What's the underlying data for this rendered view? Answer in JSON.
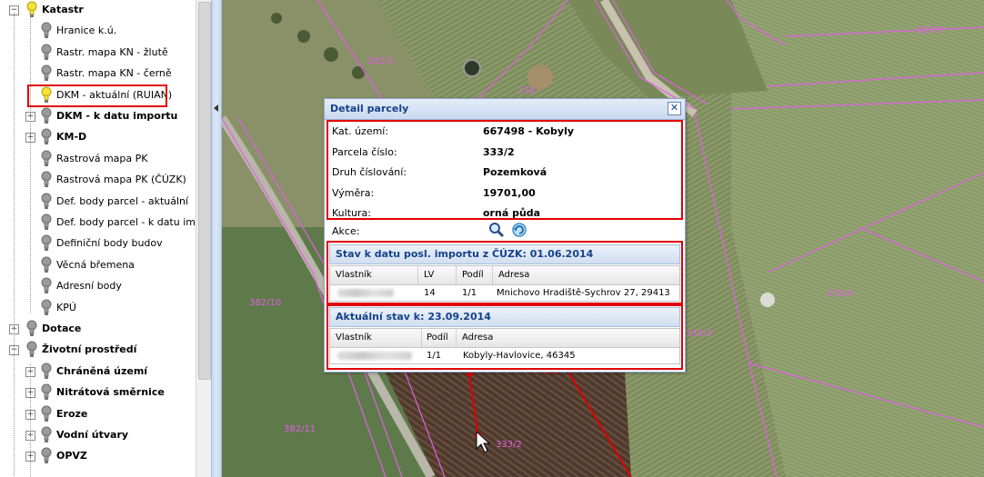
{
  "tree": {
    "items": [
      {
        "label": "Katastr",
        "level": 0,
        "bold": true,
        "expander": "−",
        "bulb": "yellow"
      },
      {
        "label": "Hranice k.ú.",
        "level": 1,
        "bold": false,
        "expander": "",
        "bulb": "gray"
      },
      {
        "label": "Rastr. mapa KN - žlutě",
        "level": 1,
        "bold": false,
        "expander": "",
        "bulb": "gray"
      },
      {
        "label": "Rastr. mapa KN - černě",
        "level": 1,
        "bold": false,
        "expander": "",
        "bulb": "gray"
      },
      {
        "label": "DKM - aktuální (RUIAN)",
        "level": 1,
        "bold": false,
        "expander": "",
        "bulb": "yellow"
      },
      {
        "label": "DKM - k datu importu",
        "level": 1,
        "bold": true,
        "expander": "+",
        "bulb": "gray"
      },
      {
        "label": "KM-D",
        "level": 1,
        "bold": true,
        "expander": "+",
        "bulb": "gray"
      },
      {
        "label": "Rastrová mapa PK",
        "level": 1,
        "bold": false,
        "expander": "",
        "bulb": "gray"
      },
      {
        "label": "Rastrová mapa PK (ČÚZK)",
        "level": 1,
        "bold": false,
        "expander": "",
        "bulb": "gray"
      },
      {
        "label": "Def. body parcel - aktuální",
        "level": 1,
        "bold": false,
        "expander": "",
        "bulb": "gray"
      },
      {
        "label": "Def. body parcel - k datu impo",
        "level": 1,
        "bold": false,
        "expander": "",
        "bulb": "gray"
      },
      {
        "label": "Definiční body budov",
        "level": 1,
        "bold": false,
        "expander": "",
        "bulb": "gray"
      },
      {
        "label": "Věcná břemena",
        "level": 1,
        "bold": false,
        "expander": "",
        "bulb": "gray"
      },
      {
        "label": "Adresní body",
        "level": 1,
        "bold": false,
        "expander": "",
        "bulb": "gray"
      },
      {
        "label": "KPÚ",
        "level": 1,
        "bold": false,
        "expander": "",
        "bulb": "gray"
      },
      {
        "label": "Dotace",
        "level": 0,
        "bold": true,
        "expander": "+",
        "bulb": "gray"
      },
      {
        "label": "Životní prostředí",
        "level": 0,
        "bold": true,
        "expander": "−",
        "bulb": "gray"
      },
      {
        "label": "Chráněná území",
        "level": 1,
        "bold": true,
        "expander": "+",
        "bulb": "gray"
      },
      {
        "label": "Nitrátová směrnice",
        "level": 1,
        "bold": true,
        "expander": "+",
        "bulb": "gray"
      },
      {
        "label": "Eroze",
        "level": 1,
        "bold": true,
        "expander": "+",
        "bulb": "gray"
      },
      {
        "label": "Vodní útvary",
        "level": 1,
        "bold": true,
        "expander": "+",
        "bulb": "gray"
      },
      {
        "label": "OPVZ",
        "level": 1,
        "bold": true,
        "expander": "+",
        "bulb": "gray"
      }
    ]
  },
  "map": {
    "labels": [
      "202/1",
      "178",
      "537/7",
      "382/10",
      "333/4",
      "333/3",
      "382/11",
      "333/2"
    ]
  },
  "dialog": {
    "title": "Detail parcely",
    "close_symbol": "✕",
    "fields": [
      {
        "label": "Kat. území:",
        "value": "667498 - Kobyly"
      },
      {
        "label": "Parcela číslo:",
        "value": "333/2"
      },
      {
        "label": "Druh číslování:",
        "value": "Pozemková"
      },
      {
        "label": "Výměra:",
        "value": "19701,00"
      },
      {
        "label": "Kultura:",
        "value": "orná půda"
      }
    ],
    "actions_label": "Akce:",
    "section1": {
      "title": "Stav k datu posl. importu z ČÚZK: 01.06.2014",
      "columns": [
        "Vlastník",
        "LV",
        "Podíl",
        "Adresa"
      ],
      "row": {
        "lv": "14",
        "podil": "1/1",
        "adresa": "Mnichovo Hradiště-Sychrov 27, 29413"
      }
    },
    "section2": {
      "title": "Aktuální stav k: 23.09.2014",
      "columns": [
        "Vlastník",
        "Podíl",
        "Adresa"
      ],
      "row": {
        "podil": "1/1",
        "adresa": "Kobyly-Havlovice, 46345"
      }
    }
  },
  "colors": {
    "highlight": "#e00000",
    "parcel_line": "#e35fe6",
    "header_text": "#15428b"
  }
}
